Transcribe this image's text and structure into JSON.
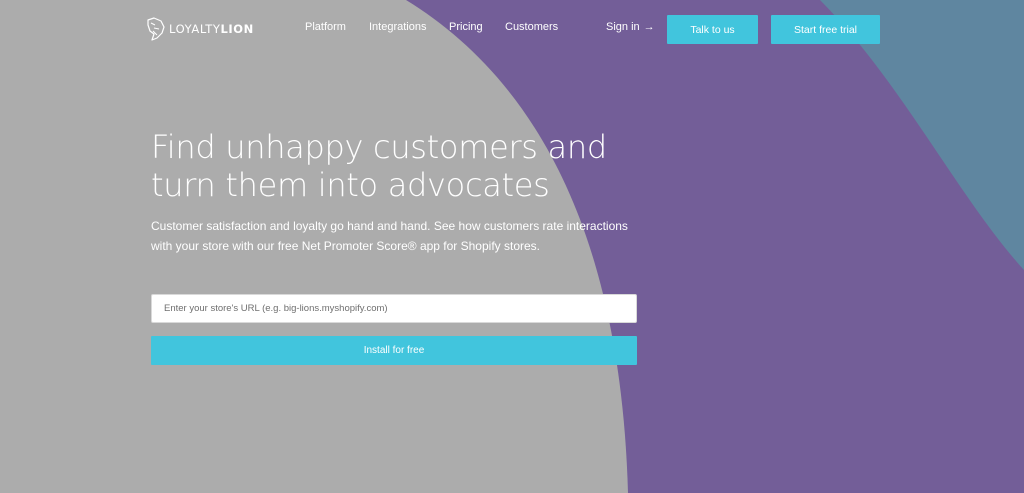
{
  "header": {
    "logo": {
      "text_regular": "LOYALTY",
      "text_bold": "LION",
      "icon": "lion-head-icon"
    },
    "nav": [
      {
        "label": "Platform"
      },
      {
        "label": "Integrations"
      },
      {
        "label": "Pricing"
      },
      {
        "label": "Customers"
      }
    ],
    "signin_label": "Sign in",
    "signin_arrow": "→",
    "talk_label": "Talk to us",
    "trial_label": "Start free trial"
  },
  "hero": {
    "headline": "Find unhappy customers and turn them into advocates",
    "subtext": "Customer satisfaction and loyalty go hand and hand. See how customers rate interactions with your store with our free Net Promoter Score® app for Shopify stores.",
    "url_input": {
      "value": "",
      "placeholder": "Enter your store's URL (e.g. big-lions.myshopify.com)"
    },
    "install_label": "Install for free"
  },
  "colors": {
    "background_gray": "#acacac",
    "purple": "#735e98",
    "slate_blue": "#5f86a0",
    "accent_cyan": "#41c5dd",
    "text_white": "#ffffff"
  }
}
